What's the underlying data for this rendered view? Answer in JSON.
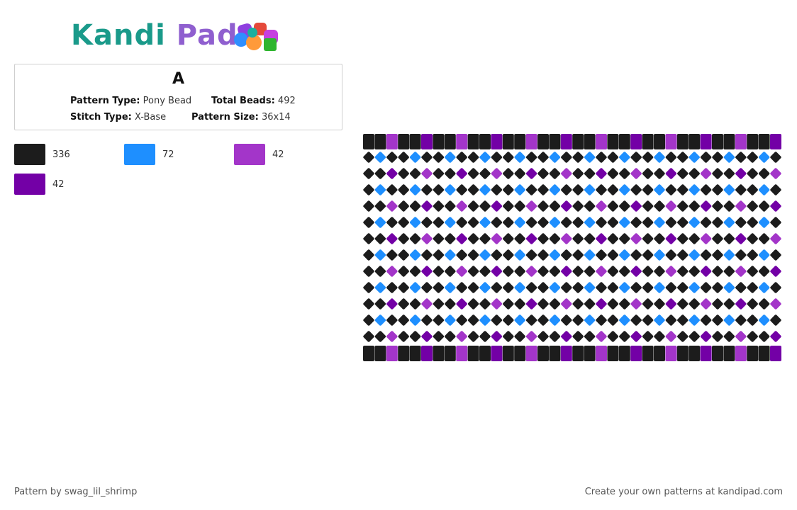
{
  "header": {
    "logo_text_left": "Kandi",
    "logo_text_right": "Pad"
  },
  "pattern": {
    "title": "A",
    "type_label": "Pattern Type:",
    "type_value": "Pony Bead",
    "beads_label": "Total Beads:",
    "beads_value": "492",
    "stitch_label": "Stitch Type:",
    "stitch_value": "X-Base",
    "size_label": "Pattern Size:",
    "size_value": "36x14"
  },
  "palette": [
    {
      "color": "#1c1c1c",
      "count": "336"
    },
    {
      "color": "#1e8fff",
      "count": "72"
    },
    {
      "color": "#a335c9",
      "count": "42"
    },
    {
      "color": "#7300a6",
      "count": "42"
    }
  ],
  "grid": {
    "columns": 36,
    "rows": 14
  },
  "footer": {
    "credit": "Pattern by swag_lil_shrimp",
    "promo": "Create your own patterns at kandipad.com"
  }
}
